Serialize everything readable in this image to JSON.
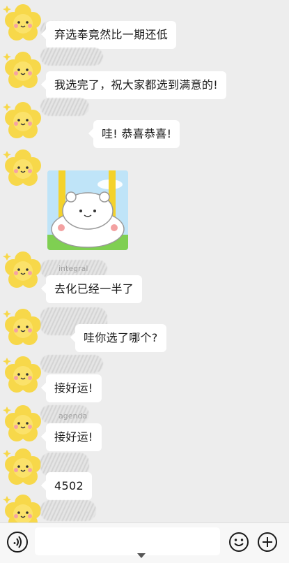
{
  "messages": [
    {
      "type": "text",
      "text": "弃选奉竟然比一期还低"
    },
    {
      "type": "text",
      "text": "我选完了，祝大家都选到满意的!"
    },
    {
      "type": "text",
      "text": "哇!  恭喜恭喜!"
    },
    {
      "type": "sticker",
      "sticker": "mochi-bear-on-swing"
    },
    {
      "type": "text",
      "sender": "integral",
      "text": "去化已经一半了"
    },
    {
      "type": "text",
      "text": "哇你选了哪个?"
    },
    {
      "type": "text",
      "text": "接好运!"
    },
    {
      "type": "text",
      "sender": "agenda",
      "text": "接好运!"
    },
    {
      "type": "text",
      "text": "4502"
    }
  ],
  "input_bar": {
    "voice_icon": "voice-icon",
    "emoji_icon": "emoji-smile-icon",
    "plus_icon": "plus-circle-icon",
    "input_value": ""
  },
  "colors": {
    "background": "#ededed",
    "bubble": "#ffffff",
    "avatar_flower": "#f7d84a",
    "sticker_swing": "#f4d22b"
  }
}
